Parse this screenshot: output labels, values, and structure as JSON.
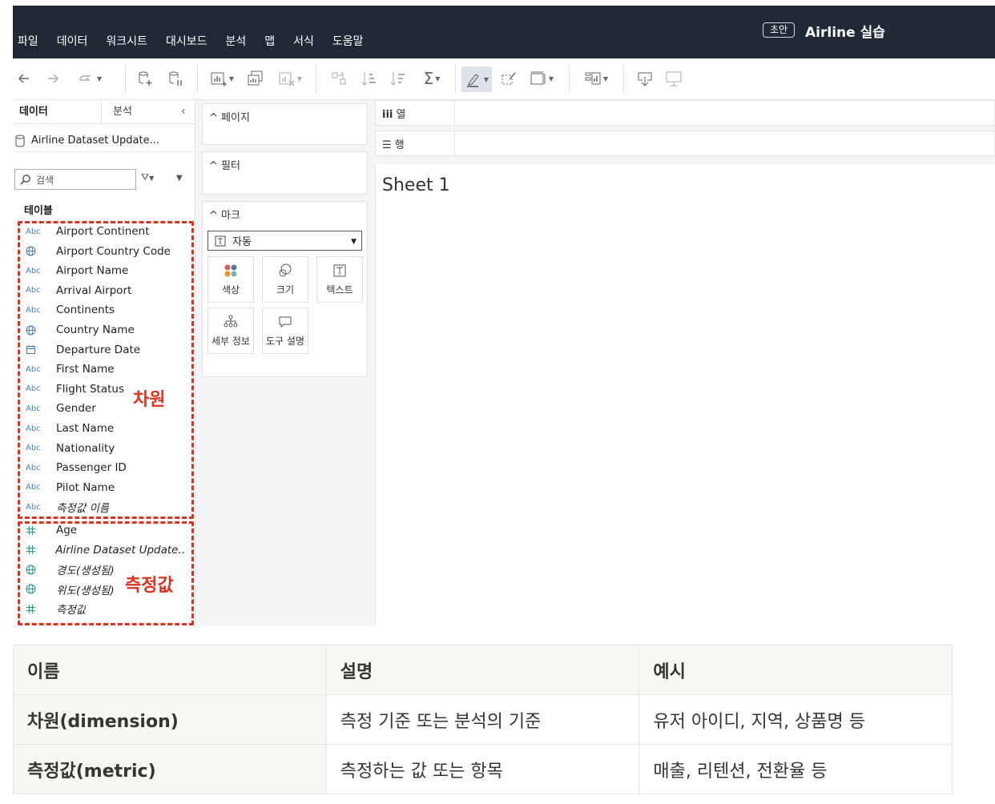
{
  "window": {
    "status_badge": "초안",
    "title": "Airline 실습",
    "menu": [
      "파일",
      "데이터",
      "워크시트",
      "대시보드",
      "분석",
      "맵",
      "서식",
      "도움말"
    ]
  },
  "data_pane": {
    "tab_data": "데이터",
    "tab_analysis": "분석",
    "datasource": "Airline Dataset Update...",
    "search_placeholder": "검색",
    "section_tables": "테이블",
    "dimensions": [
      {
        "type": "Abc",
        "icon": "string-icon",
        "name": "Airport Continent"
      },
      {
        "type": "geo",
        "icon": "globe-icon",
        "name": "Airport Country Code"
      },
      {
        "type": "Abc",
        "icon": "string-icon",
        "name": "Airport Name"
      },
      {
        "type": "Abc",
        "icon": "string-icon",
        "name": "Arrival Airport"
      },
      {
        "type": "Abc",
        "icon": "string-icon",
        "name": "Continents"
      },
      {
        "type": "geo",
        "icon": "globe-icon",
        "name": "Country Name"
      },
      {
        "type": "date",
        "icon": "calendar-icon",
        "name": "Departure Date"
      },
      {
        "type": "Abc",
        "icon": "string-icon",
        "name": "First Name"
      },
      {
        "type": "Abc",
        "icon": "string-icon",
        "name": "Flight Status"
      },
      {
        "type": "Abc",
        "icon": "string-icon",
        "name": "Gender"
      },
      {
        "type": "Abc",
        "icon": "string-icon",
        "name": "Last Name"
      },
      {
        "type": "Abc",
        "icon": "string-icon",
        "name": "Nationality"
      },
      {
        "type": "Abc",
        "icon": "string-icon",
        "name": "Passenger ID"
      },
      {
        "type": "Abc",
        "icon": "string-icon",
        "name": "Pilot Name"
      },
      {
        "type": "Abc",
        "icon": "string-icon",
        "name": "측정값 이름",
        "italic": true
      }
    ],
    "measures": [
      {
        "type": "num",
        "icon": "hash-icon",
        "name": "Age"
      },
      {
        "type": "num",
        "icon": "hash-icon",
        "name": "Airline Dataset Update...",
        "italic": true
      },
      {
        "type": "geo",
        "icon": "globe-icon",
        "name": "경도(생성됨)",
        "italic": true
      },
      {
        "type": "geo",
        "icon": "globe-icon",
        "name": "위도(생성됨)",
        "italic": true
      },
      {
        "type": "num",
        "icon": "hash-icon",
        "name": "측정값",
        "italic": true
      }
    ],
    "annotation_dimension": "차원",
    "annotation_measure": "측정값"
  },
  "cards": {
    "pages": "페이지",
    "filters": "필터",
    "marks": "마크",
    "marks_type": "자동",
    "buttons": [
      "색상",
      "크기",
      "텍스트",
      "세부 정보",
      "도구 설명"
    ]
  },
  "shelves": {
    "columns": "열",
    "rows": "행",
    "sheet_title": "Sheet 1"
  },
  "comparison_table": {
    "header": [
      "이름",
      "설명",
      "예시"
    ],
    "rows": [
      [
        "차원(dimension)",
        "측정 기준 또는 분석의 기준",
        "유저 아이디, 지역, 상품명 등"
      ],
      [
        "측정값(metric)",
        "측정하는 값 또는 항목",
        "매출, 리텐션, 전환율 등"
      ]
    ]
  },
  "colors": {
    "menubar": "#1f2a36",
    "annotation_red": "#e0301e",
    "dimension_blue": "#4a7fb4",
    "measure_green": "#2e9e87"
  }
}
